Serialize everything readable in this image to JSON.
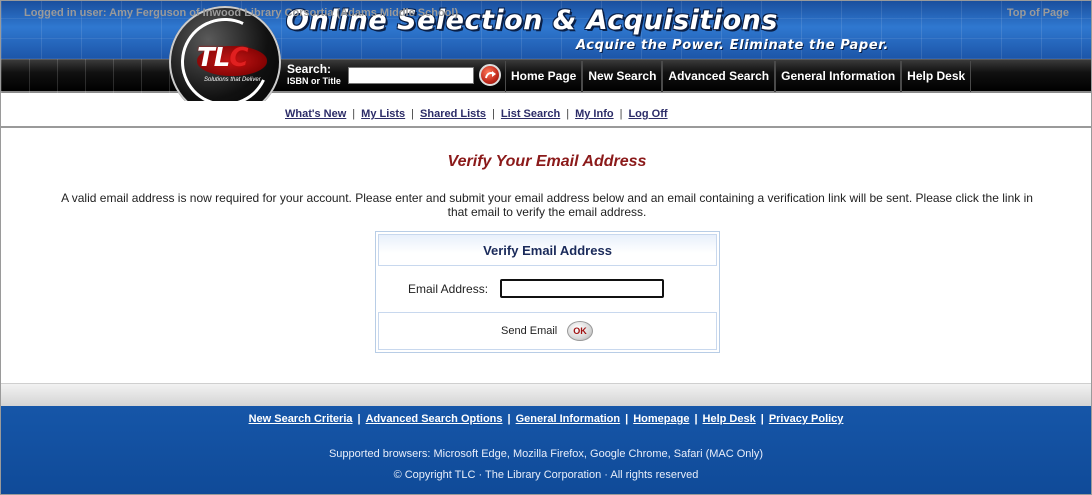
{
  "header": {
    "title": "Online Selection & Acquisitions",
    "tagline": "Acquire the Power. Eliminate the Paper.",
    "logo_text_main": "TL",
    "logo_text_c": "C",
    "logo_sub": "Solutions that Deliver"
  },
  "search": {
    "label": "Search:",
    "sublabel": "ISBN or Title",
    "value": ""
  },
  "nav": {
    "items": [
      "Home Page",
      "New Search",
      "Advanced Search",
      "General Information",
      "Help Desk"
    ]
  },
  "subnav": {
    "items": [
      "What's New",
      "My Lists",
      "Shared Lists",
      "List Search",
      "My Info",
      "Log Off"
    ],
    "separator": "|"
  },
  "main": {
    "title": "Verify Your Email Address",
    "intro": "A valid email address is now required for your account. Please enter and submit your email address below and an email containing a verification link will be sent. Please click the link in that email to verify the email address."
  },
  "form": {
    "heading": "Verify Email Address",
    "email_label": "Email Address:",
    "email_value": "",
    "send_label": "Send Email",
    "ok_label": "OK"
  },
  "status": {
    "logged_in": "Logged in user: Amy Ferguson of Inwood Library Corsortia (Adams Middle School)",
    "top_link": "Top of Page"
  },
  "footer": {
    "links": [
      "New Search Criteria",
      "Advanced Search Options",
      "General Information",
      "Homepage",
      "Help Desk",
      "Privacy Policy"
    ],
    "separator": "|",
    "browsers": "Supported browsers: Microsoft Edge, Mozilla Firefox, Google Chrome, Safari (MAC Only)",
    "copyright": "© Copyright TLC · The Library Corporation · All rights reserved"
  },
  "colors": {
    "banner_blue": "#2f78d0",
    "title_red": "#8b1a1a",
    "footer_blue": "#1656a8"
  }
}
